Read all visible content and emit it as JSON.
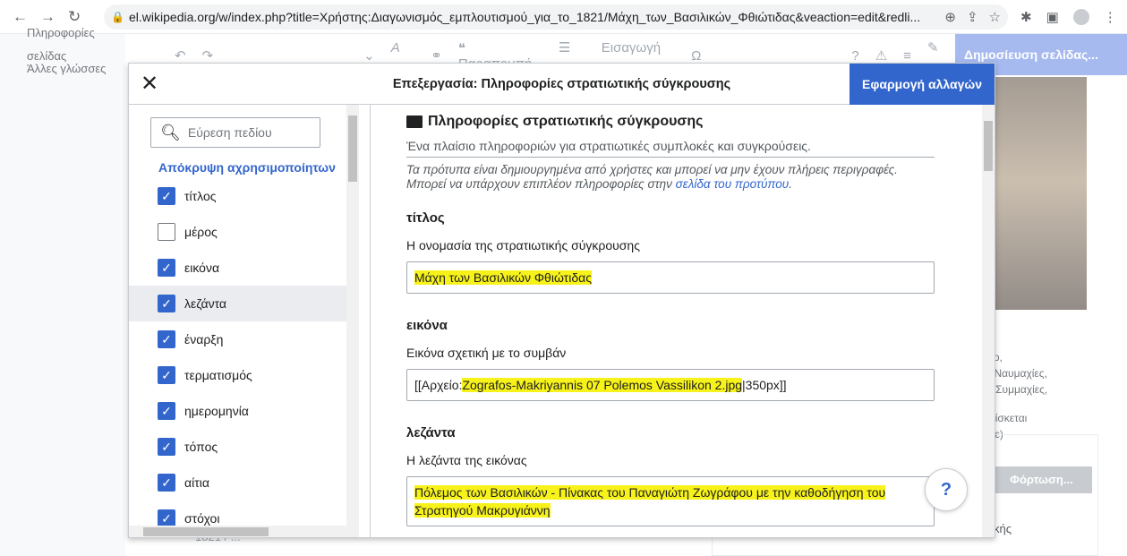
{
  "browser": {
    "url": "el.wikipedia.org/w/index.php?title=Χρήστης:Διαγωνισμός_εμπλουτισμού_για_το_1821/Μάχη_των_Βασιλικών_Φθιώτιδας&veaction=edit&redli..."
  },
  "leftnav": {
    "item1": "Πληροφορίες σελίδας",
    "item2": "Άλλες γλώσσες"
  },
  "toolbar": {
    "quote": "Παραπομπή",
    "insert": "Εισαγωγή",
    "publish": "Δημοσίευση σελίδας..."
  },
  "side": {
    "line1": "γκο,",
    "line2": "ς, Ναυμαχίες,",
    "line3": "Σ, Συμμαχίες,",
    "line4": "βρίσκεται",
    "line5": "υμε)",
    "upload": "Φόρτωση...",
    "line6": "κής"
  },
  "under": {
    "text": "1821 / ..."
  },
  "dialog": {
    "title": "Επεξεργασία: Πληροφορίες στρατιωτικής σύγκρουσης",
    "apply": "Εφαρμογή αλλαγών",
    "search_placeholder": "Εύρεση πεδίου",
    "hide_unused": "Απόκρυψη αχρησιμοποίητων",
    "params": [
      {
        "label": "τίτλος",
        "checked": true
      },
      {
        "label": "μέρος",
        "checked": false
      },
      {
        "label": "εικόνα",
        "checked": true
      },
      {
        "label": "λεζάντα",
        "checked": true
      },
      {
        "label": "έναρξη",
        "checked": true
      },
      {
        "label": "τερματισμός",
        "checked": true
      },
      {
        "label": "ημερομηνία",
        "checked": true
      },
      {
        "label": "τόπος",
        "checked": true
      },
      {
        "label": "αίτια",
        "checked": true
      },
      {
        "label": "στόχοι",
        "checked": true
      }
    ],
    "template": {
      "name": "Πληροφορίες στρατιωτικής σύγκρουσης",
      "description": "Ένα πλαίσιο πληροφοριών για στρατιωτικές συμπλοκές και συγκρούσεις.",
      "note": "Τα πρότυπα είναι δημιουργημένα από χρήστες και μπορεί να μην έχουν πλήρεις περιγραφές. Μπορεί να υπάρχουν επιπλέον πληροφορίες στην ",
      "note_link": "σελίδα του προτύπου",
      "note_end": "."
    },
    "fields": {
      "title": {
        "name": "τίτλος",
        "desc": "Η ονομασία της στρατιωτικής σύγκρουσης",
        "value": "Μάχη των Βασιλικών Φθιώτιδας"
      },
      "image": {
        "name": "εικόνα",
        "desc": "Εικόνα σχετική με το συμβάν",
        "prefix": "[[Αρχείο:",
        "value": "Zografos-Makriyannis 07 Polemos Vassilikon 2.jpg",
        "suffix": "|350px]]"
      },
      "caption": {
        "name": "λεζάντα",
        "desc": "Η λεζάντα της εικόνας",
        "value_line1": "Πόλεμος των Βασιλικών - Πίνακας του Παναγιώτη Ζωγράφου με την καθοδήγηση του",
        "value_line2": "Στρατηγού Μακρυγιάννη"
      }
    }
  },
  "help": "?"
}
